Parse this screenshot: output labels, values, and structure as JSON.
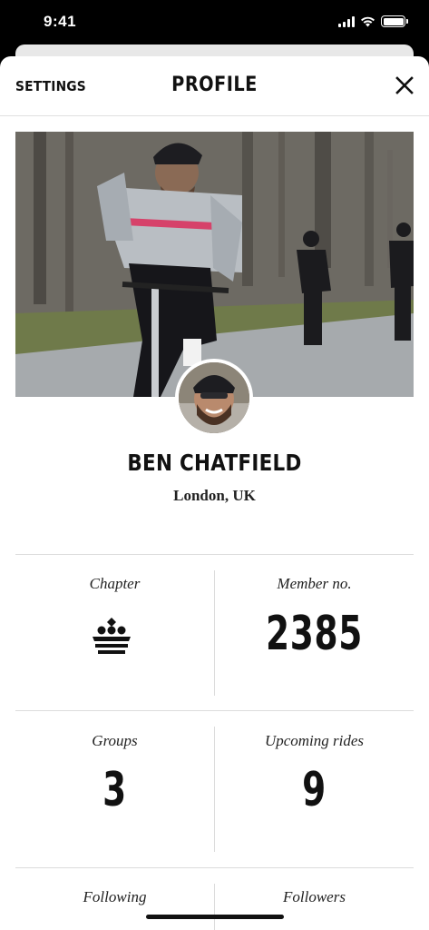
{
  "status_bar": {
    "time": "9:41",
    "icons": [
      "cellular-signal-icon",
      "wifi-icon",
      "battery-icon"
    ]
  },
  "nav": {
    "settings_label": "SETTINGS",
    "title": "PROFILE",
    "close_icon": "close-icon"
  },
  "profile": {
    "name": "BEN CHATFIELD",
    "location": "London, UK"
  },
  "stats": {
    "chapter_label": "Chapter",
    "chapter_icon": "crown-icon",
    "member_label": "Member no.",
    "member_value": "2385",
    "groups_label": "Groups",
    "groups_value": "3",
    "rides_label": "Upcoming rides",
    "rides_value": "9",
    "following_label": "Following",
    "followers_label": "Followers"
  },
  "colors": {
    "background": "#ffffff",
    "text": "#111111",
    "divider": "#dcdcdc"
  }
}
